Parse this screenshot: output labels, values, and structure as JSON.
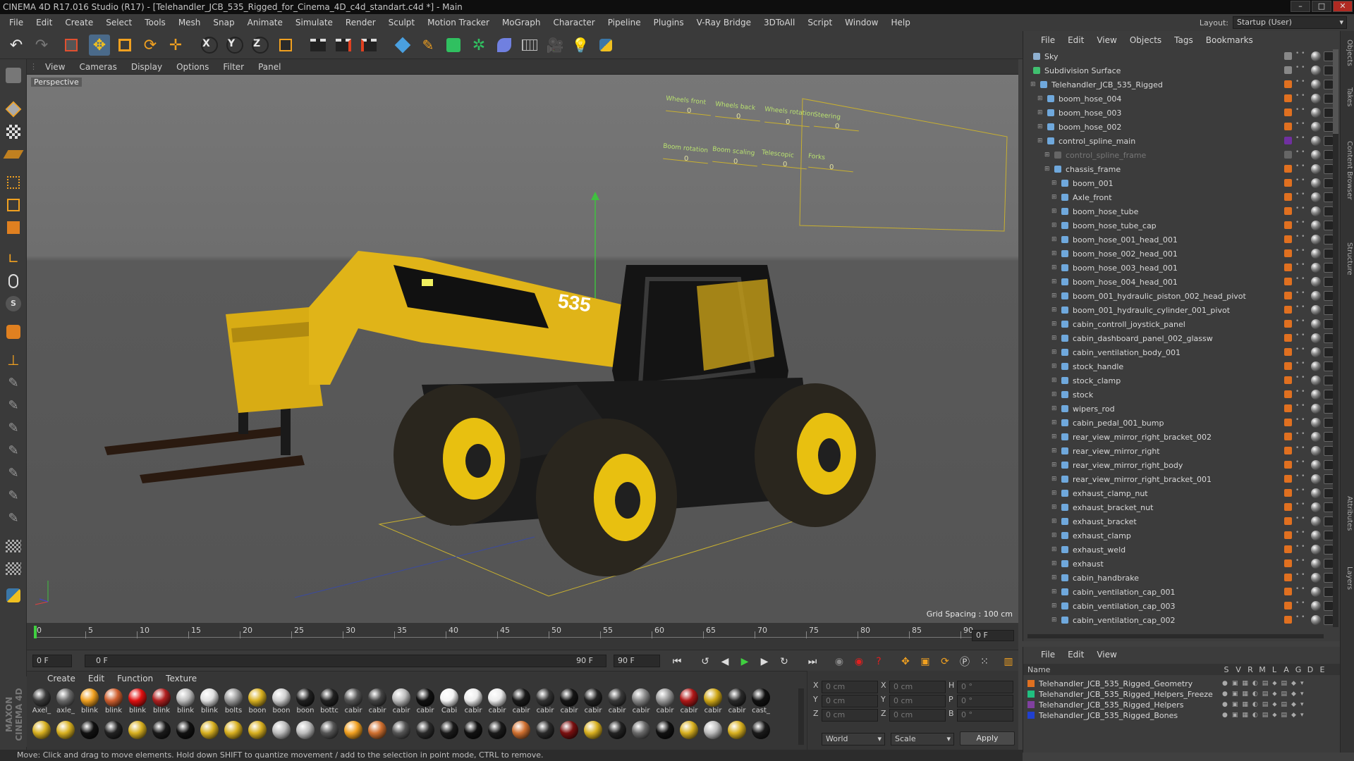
{
  "window": {
    "title": "CINEMA 4D R17.016 Studio (R17) - [Telehandler_JCB_535_Rigged_for_Cinema_4D_c4d_standart.c4d *] - Main"
  },
  "menubar": [
    "File",
    "Edit",
    "Create",
    "Select",
    "Tools",
    "Mesh",
    "Snap",
    "Animate",
    "Simulate",
    "Render",
    "Sculpt",
    "Motion Tracker",
    "MoGraph",
    "Character",
    "Pipeline",
    "Plugins",
    "V-Ray Bridge",
    "3DToAll",
    "Script",
    "Window",
    "Help"
  ],
  "layout": {
    "label": "Layout:",
    "value": "Startup (User)"
  },
  "toolbar": {
    "axis_x": "X",
    "axis_y": "Y",
    "axis_z": "Z"
  },
  "viewport": {
    "menu": [
      "View",
      "Cameras",
      "Display",
      "Options",
      "Filter",
      "Panel"
    ],
    "camera_label": "Perspective",
    "grid_spacing": "Grid Spacing : 100 cm",
    "control_labels": [
      "Wheels front",
      "Wheels back",
      "Wheels rotation",
      "Steering",
      "Boom rotation",
      "Boom scaling",
      "Telescopic",
      "Forks"
    ],
    "control_values": [
      "0",
      "0",
      "0",
      "0",
      "0",
      "0",
      "0",
      "0"
    ]
  },
  "timeline": {
    "ticks": [
      "0",
      "5",
      "10",
      "15",
      "20",
      "25",
      "30",
      "35",
      "40",
      "45",
      "50",
      "55",
      "60",
      "65",
      "70",
      "75",
      "80",
      "85",
      "90"
    ],
    "end_frame_display": "0 F",
    "current_frame": "0 F",
    "range_start": "0 F",
    "range_end": "90 F",
    "max_frame": "90 F"
  },
  "material_manager": {
    "menu": [
      "Create",
      "Edit",
      "Function",
      "Texture"
    ],
    "row1": [
      {
        "label": "Axel_",
        "color": "#3a3a3a"
      },
      {
        "label": "axle_",
        "color": "#6a6a6a"
      },
      {
        "label": "blink",
        "color": "#f0a020"
      },
      {
        "label": "blink",
        "color": "#d06030"
      },
      {
        "label": "blink",
        "color": "#e01010"
      },
      {
        "label": "blink",
        "color": "#b02020"
      },
      {
        "label": "blink",
        "color": "#bdbdbd"
      },
      {
        "label": "blink",
        "color": "#e0e0e0"
      },
      {
        "label": "bolts",
        "color": "#9a9a9a"
      },
      {
        "label": "boon",
        "color": "#d8b020"
      },
      {
        "label": "boon",
        "color": "#cfcfcf"
      },
      {
        "label": "boon",
        "color": "#202020"
      },
      {
        "label": "bottc",
        "color": "#222222"
      },
      {
        "label": "cabir",
        "color": "#555555"
      },
      {
        "label": "cabir",
        "color": "#444444"
      },
      {
        "label": "cabir",
        "color": "#bdbdbd"
      },
      {
        "label": "cabir",
        "color": "#101010"
      },
      {
        "label": "Cabi",
        "color": "#f4f4f4"
      },
      {
        "label": "cabir",
        "color": "#ececec"
      },
      {
        "label": "cabir",
        "color": "#ececec"
      },
      {
        "label": "cabir",
        "color": "#1a1a1a"
      },
      {
        "label": "cabir",
        "color": "#333333"
      },
      {
        "label": "cabir",
        "color": "#151515"
      },
      {
        "label": "cabir",
        "color": "#222222"
      },
      {
        "label": "cabir",
        "color": "#3a3a3a"
      },
      {
        "label": "cabir",
        "color": "#8a8a8a"
      },
      {
        "label": "cabir",
        "color": "#9a9a9a"
      },
      {
        "label": "cabir",
        "color": "#b01818"
      },
      {
        "label": "cabir",
        "color": "#d0a818"
      },
      {
        "label": "cabir",
        "color": "#2a2a2a"
      },
      {
        "label": "cast_",
        "color": "#111111"
      }
    ],
    "row2": [
      "#d8b020",
      "#d8b020",
      "#111111",
      "#222222",
      "#d8b020",
      "#1a1a1a",
      "#111111",
      "#d8b020",
      "#d8b020",
      "#d8b020",
      "#bdbdbd",
      "#bdbdbd",
      "#555555",
      "#f0a020",
      "#d07030",
      "#555555",
      "#2a2a2a",
      "#1a1a1a",
      "#111111",
      "#1a1a1a",
      "#d07030",
      "#2a2a2a",
      "#7a1010",
      "#d8b020",
      "#222222",
      "#6a6a6a",
      "#111111",
      "#d8b020",
      "#bdbdbd",
      "#d8b020",
      "#1a1a1a"
    ]
  },
  "coordinates": {
    "rows": [
      {
        "a": "X",
        "av": "0 cm",
        "b": "X",
        "bv": "0 cm",
        "c": "H",
        "cv": "0 °"
      },
      {
        "a": "Y",
        "av": "0 cm",
        "b": "Y",
        "bv": "0 cm",
        "c": "P",
        "cv": "0 °"
      },
      {
        "a": "Z",
        "av": "0 cm",
        "b": "Z",
        "bv": "0 cm",
        "c": "B",
        "cv": "0 °"
      }
    ],
    "mode": "World",
    "transform": "Scale",
    "apply": "Apply"
  },
  "object_manager": {
    "menu": [
      "File",
      "Edit",
      "View",
      "Objects",
      "Tags",
      "Bookmarks"
    ],
    "items": [
      {
        "name": "Sky",
        "level": 0,
        "color": "#8fb0d0",
        "tag": "#888888"
      },
      {
        "name": "Subdivision Surface",
        "level": 0,
        "color": "#40c070",
        "tag": "#888888"
      },
      {
        "name": "Telehandler_JCB_535_Rigged",
        "level": 1,
        "color": "#6fa8dc",
        "tag": "#e07020"
      },
      {
        "name": "boom_hose_004",
        "level": 2,
        "color": "#6fa8dc",
        "tag": "#e07020"
      },
      {
        "name": "boom_hose_003",
        "level": 2,
        "color": "#6fa8dc",
        "tag": "#e07020"
      },
      {
        "name": "boom_hose_002",
        "level": 2,
        "color": "#6fa8dc",
        "tag": "#e07020"
      },
      {
        "name": "control_spline_main",
        "level": 2,
        "color": "#6fa8dc",
        "tag": "#7030a0"
      },
      {
        "name": "control_spline_frame",
        "level": 3,
        "color": "#666666",
        "tag": "#666666"
      },
      {
        "name": "chassis_frame",
        "level": 3,
        "color": "#6fa8dc",
        "tag": "#e07020"
      },
      {
        "name": "boom_001",
        "level": 4,
        "color": "#6fa8dc",
        "tag": "#e07020"
      },
      {
        "name": "Axle_front",
        "level": 4,
        "color": "#6fa8dc",
        "tag": "#e07020"
      },
      {
        "name": "boom_hose_tube",
        "level": 4,
        "color": "#6fa8dc",
        "tag": "#e07020"
      },
      {
        "name": "boom_hose_tube_cap",
        "level": 4,
        "color": "#6fa8dc",
        "tag": "#e07020"
      },
      {
        "name": "boom_hose_001_head_001",
        "level": 4,
        "color": "#6fa8dc",
        "tag": "#e07020"
      },
      {
        "name": "boom_hose_002_head_001",
        "level": 4,
        "color": "#6fa8dc",
        "tag": "#e07020"
      },
      {
        "name": "boom_hose_003_head_001",
        "level": 4,
        "color": "#6fa8dc",
        "tag": "#e07020"
      },
      {
        "name": "boom_hose_004_head_001",
        "level": 4,
        "color": "#6fa8dc",
        "tag": "#e07020"
      },
      {
        "name": "boom_001_hydraulic_piston_002_head_pivot",
        "level": 4,
        "color": "#6fa8dc",
        "tag": "#e07020"
      },
      {
        "name": "boom_001_hydraulic_cylinder_001_pivot",
        "level": 4,
        "color": "#6fa8dc",
        "tag": "#e07020"
      },
      {
        "name": "cabin_controll_joystick_panel",
        "level": 4,
        "color": "#6fa8dc",
        "tag": "#e07020"
      },
      {
        "name": "cabin_dashboard_panel_002_glassw",
        "level": 4,
        "color": "#6fa8dc",
        "tag": "#e07020"
      },
      {
        "name": "cabin_ventilation_body_001",
        "level": 4,
        "color": "#6fa8dc",
        "tag": "#e07020"
      },
      {
        "name": "stock_handle",
        "level": 4,
        "color": "#6fa8dc",
        "tag": "#e07020"
      },
      {
        "name": "stock_clamp",
        "level": 4,
        "color": "#6fa8dc",
        "tag": "#e07020"
      },
      {
        "name": "stock",
        "level": 4,
        "color": "#6fa8dc",
        "tag": "#e07020"
      },
      {
        "name": "wipers_rod",
        "level": 4,
        "color": "#6fa8dc",
        "tag": "#e07020"
      },
      {
        "name": "cabin_pedal_001_bump",
        "level": 4,
        "color": "#6fa8dc",
        "tag": "#e07020"
      },
      {
        "name": "rear_view_mirror_right_bracket_002",
        "level": 4,
        "color": "#6fa8dc",
        "tag": "#e07020"
      },
      {
        "name": "rear_view_mirror_right",
        "level": 4,
        "color": "#6fa8dc",
        "tag": "#e07020"
      },
      {
        "name": "rear_view_mirror_right_body",
        "level": 4,
        "color": "#6fa8dc",
        "tag": "#e07020"
      },
      {
        "name": "rear_view_mirror_right_bracket_001",
        "level": 4,
        "color": "#6fa8dc",
        "tag": "#e07020"
      },
      {
        "name": "exhaust_clamp_nut",
        "level": 4,
        "color": "#6fa8dc",
        "tag": "#e07020"
      },
      {
        "name": "exhaust_bracket_nut",
        "level": 4,
        "color": "#6fa8dc",
        "tag": "#e07020"
      },
      {
        "name": "exhaust_bracket",
        "level": 4,
        "color": "#6fa8dc",
        "tag": "#e07020"
      },
      {
        "name": "exhaust_clamp",
        "level": 4,
        "color": "#6fa8dc",
        "tag": "#e07020"
      },
      {
        "name": "exhaust_weld",
        "level": 4,
        "color": "#6fa8dc",
        "tag": "#e07020"
      },
      {
        "name": "exhaust",
        "level": 4,
        "color": "#6fa8dc",
        "tag": "#e07020"
      },
      {
        "name": "cabin_handbrake",
        "level": 4,
        "color": "#6fa8dc",
        "tag": "#e07020"
      },
      {
        "name": "cabin_ventilation_cap_001",
        "level": 4,
        "color": "#6fa8dc",
        "tag": "#e07020"
      },
      {
        "name": "cabin_ventilation_cap_003",
        "level": 4,
        "color": "#6fa8dc",
        "tag": "#e07020"
      },
      {
        "name": "cabin_ventilation_cap_002",
        "level": 4,
        "color": "#6fa8dc",
        "tag": "#e07020"
      }
    ]
  },
  "layer_manager": {
    "menu": [
      "File",
      "Edit",
      "View"
    ],
    "header_name": "Name",
    "header_cols": [
      "S",
      "V",
      "R",
      "M",
      "L",
      "A",
      "G",
      "D",
      "E"
    ],
    "layers": [
      {
        "name": "Telehandler_JCB_535_Rigged_Geometry",
        "color": "#e07020"
      },
      {
        "name": "Telehandler_JCB_535_Rigged_Helpers_Freeze",
        "color": "#20c080"
      },
      {
        "name": "Telehandler_JCB_535_Rigged_Helpers",
        "color": "#8040a0"
      },
      {
        "name": "Telehandler_JCB_535_Rigged_Bones",
        "color": "#2040d0"
      }
    ]
  },
  "right_tabs": [
    "Objects",
    "Takes",
    "Content Browser",
    "Structure",
    "Attributes",
    "Layers"
  ],
  "brand": "MAXON CINEMA 4D",
  "status": "Move: Click and drag to move elements. Hold down SHIFT to quantize movement / add to the selection in point mode, CTRL to remove."
}
